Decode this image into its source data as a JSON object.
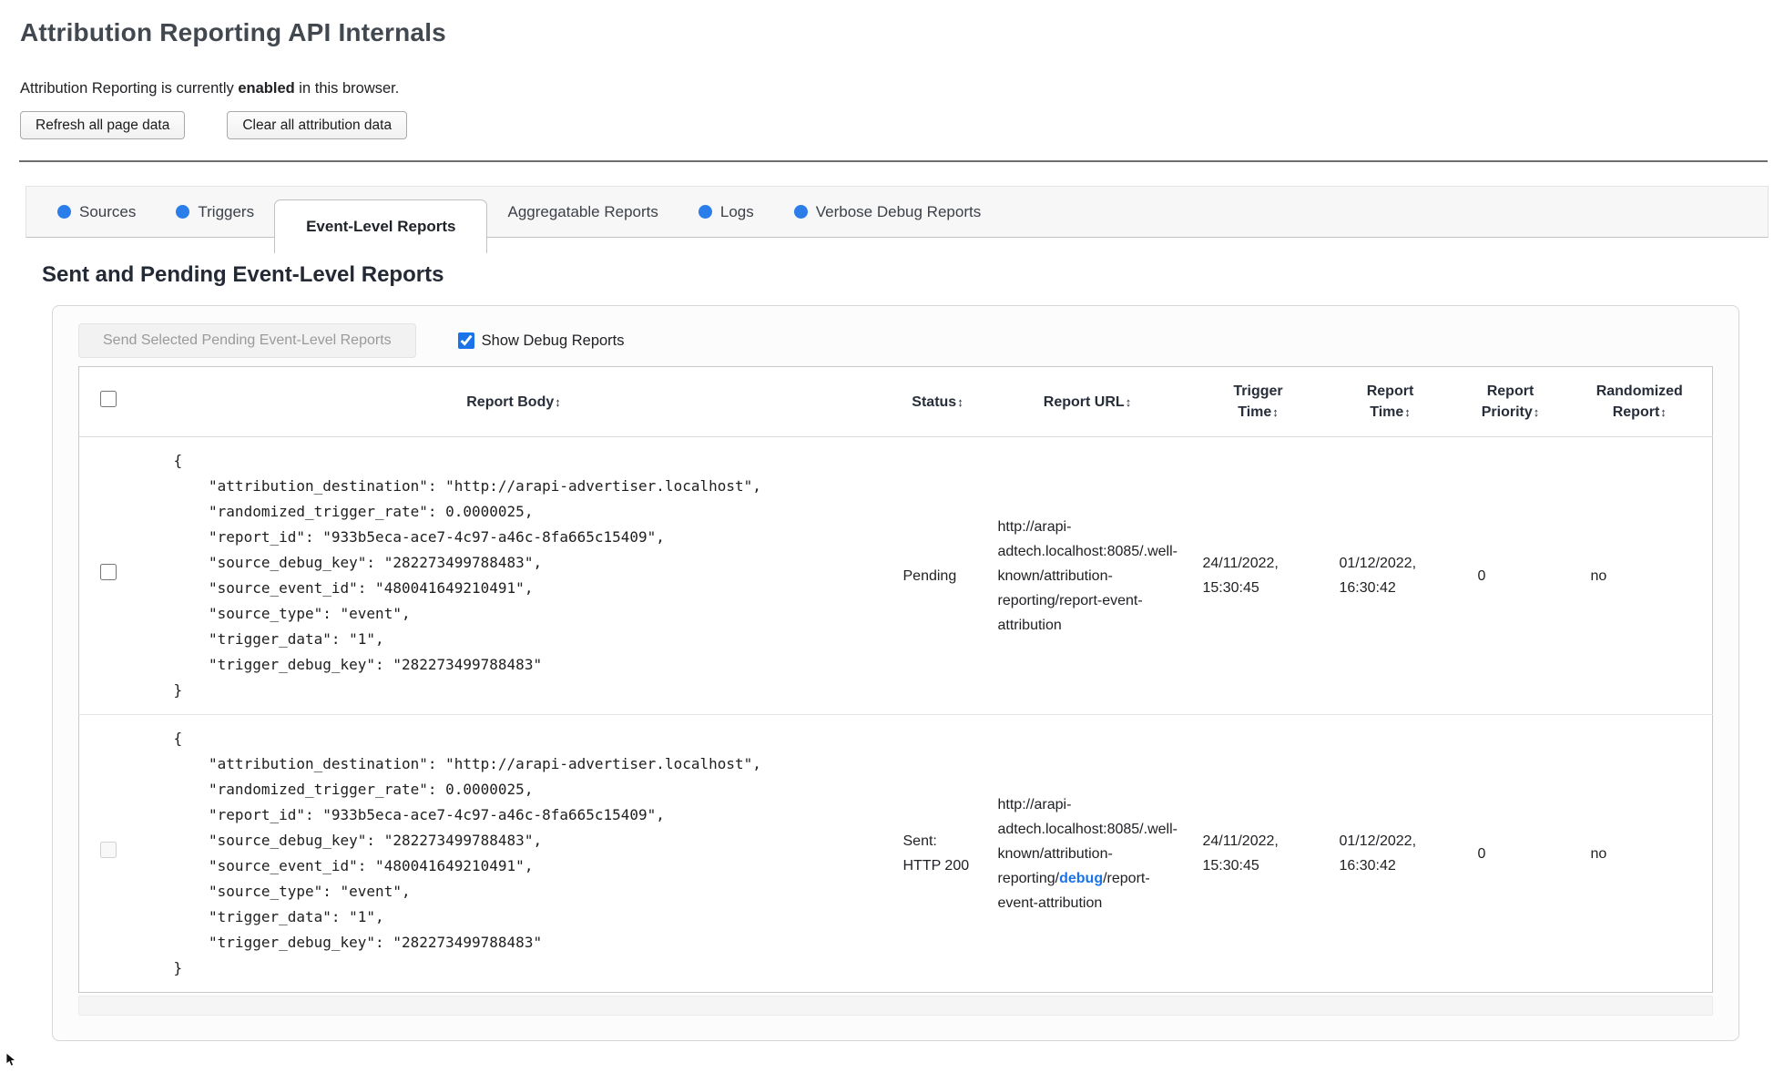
{
  "page": {
    "title": "Attribution Reporting API Internals",
    "status_prefix": "Attribution Reporting is currently ",
    "status_bold": "enabled",
    "status_suffix": " in this browser."
  },
  "toolbar": {
    "refresh_label": "Refresh all page data",
    "clear_label": "Clear all attribution data"
  },
  "tabs": [
    {
      "label": "Sources",
      "has_dot": true,
      "active": false
    },
    {
      "label": "Triggers",
      "has_dot": true,
      "active": false
    },
    {
      "label": "Event-Level Reports",
      "has_dot": false,
      "active": true
    },
    {
      "label": "Aggregatable Reports",
      "has_dot": false,
      "active": false
    },
    {
      "label": "Logs",
      "has_dot": true,
      "active": false
    },
    {
      "label": "Verbose Debug Reports",
      "has_dot": true,
      "active": false
    }
  ],
  "section": {
    "heading": "Sent and Pending Event-Level Reports",
    "send_button_label": "Send Selected Pending Event-Level Reports",
    "send_button_enabled": false,
    "show_debug_label": "Show Debug Reports",
    "show_debug_checked": true
  },
  "table": {
    "columns": {
      "body": "Report Body",
      "status": "Status",
      "url": "Report URL",
      "trigger_time": "Trigger Time",
      "report_time": "Report Time",
      "priority": "Report Priority",
      "randomized": "Randomized Report"
    },
    "rows": [
      {
        "selectable": true,
        "report_body": "{\n    \"attribution_destination\": \"http://arapi-advertiser.localhost\",\n    \"randomized_trigger_rate\": 0.0000025,\n    \"report_id\": \"933b5eca-ace7-4c97-a46c-8fa665c15409\",\n    \"source_debug_key\": \"282273499788483\",\n    \"source_event_id\": \"480041649210491\",\n    \"source_type\": \"event\",\n    \"trigger_data\": \"1\",\n    \"trigger_debug_key\": \"282273499788483\"\n}",
        "status": "Pending",
        "url_prefix": "http://arapi-adtech.localhost:8085/.well-known/attribution-reporting/report-event-attribution",
        "url_debug": "",
        "url_suffix": "",
        "trigger_time": "24/11/2022, 15:30:45",
        "report_time": "01/12/2022, 16:30:42",
        "priority": "0",
        "randomized": "no"
      },
      {
        "selectable": false,
        "report_body": "{\n    \"attribution_destination\": \"http://arapi-advertiser.localhost\",\n    \"randomized_trigger_rate\": 0.0000025,\n    \"report_id\": \"933b5eca-ace7-4c97-a46c-8fa665c15409\",\n    \"source_debug_key\": \"282273499788483\",\n    \"source_event_id\": \"480041649210491\",\n    \"source_type\": \"event\",\n    \"trigger_data\": \"1\",\n    \"trigger_debug_key\": \"282273499788483\"\n}",
        "status": "Sent: HTTP 200",
        "url_prefix": "http://arapi-adtech.localhost:8085/.well-known/attribution-reporting/",
        "url_debug": "debug",
        "url_suffix": "/report-event-attribution",
        "trigger_time": "24/11/2022, 15:30:45",
        "report_time": "01/12/2022, 16:30:42",
        "priority": "0",
        "randomized": "no"
      }
    ]
  },
  "icons": {
    "sort": "↕",
    "tab_dot": "blue-circle"
  },
  "colors": {
    "tab_dot_blue": "#2b7de9",
    "link_blue": "#1a73e8",
    "checkbox_accent": "#1a73e8"
  }
}
